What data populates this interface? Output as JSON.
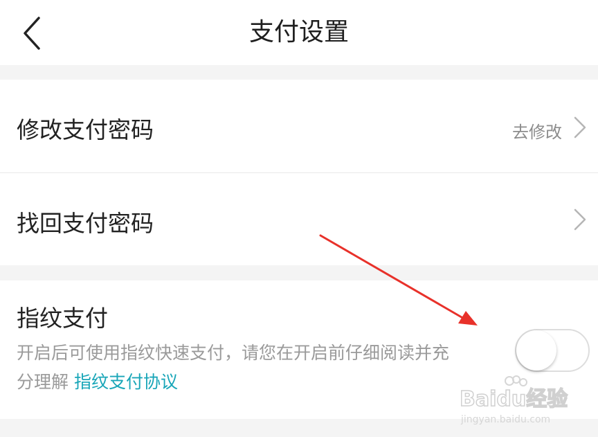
{
  "header": {
    "title": "支付设置",
    "back_icon": "chevron-left-icon"
  },
  "password_group": {
    "modify": {
      "label": "修改支付密码",
      "value": "去修改",
      "icon": "chevron-right-icon"
    },
    "recover": {
      "label": "找回支付密码",
      "icon": "chevron-right-icon"
    }
  },
  "fingerprint": {
    "label": "指纹支付",
    "description_line1": "开启后可使用指纹快速支付，请您在开启前仔细阅读并充",
    "description_line2_prefix": "分理解 ",
    "agreement_link": "指纹支付协议",
    "toggle_on": false
  },
  "watermark": {
    "brand": "Baidu经验",
    "url": "jingyan.baidu.com"
  },
  "colors": {
    "accent_link": "#19a6b8",
    "annotation_arrow": "#e8312a",
    "background": "#f4f4f4"
  }
}
